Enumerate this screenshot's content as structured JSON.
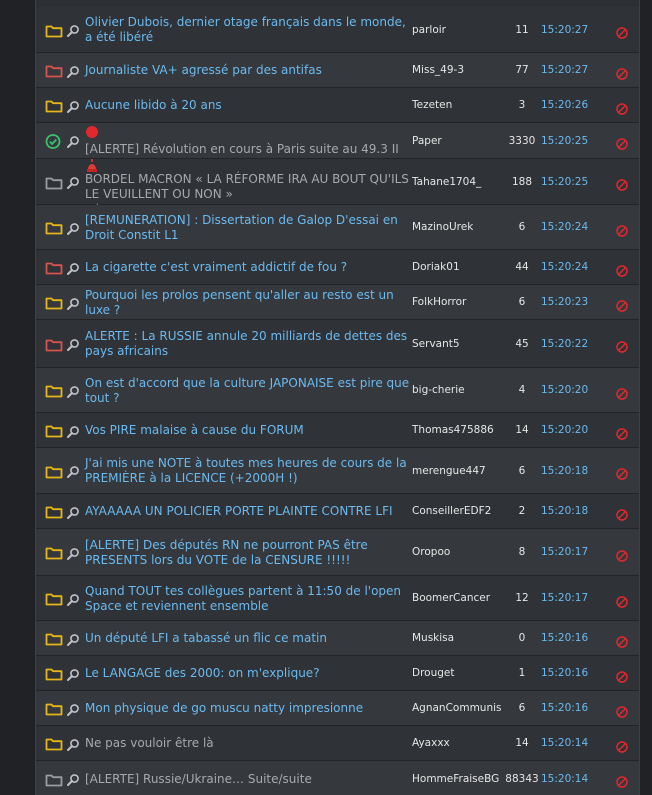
{
  "colors": {
    "folder_yellow": "#e8b61a",
    "folder_red": "#d9534f",
    "folder_dark": "#9a9da2",
    "link_blue": "#6bbaf0",
    "delete_red": "#e0282e",
    "pinned_green": "#39c26b"
  },
  "topics": [
    {
      "icon": "folder-yellow-icon",
      "title": "Olivier Dubois, dernier otage français dans le monde, a été libéré",
      "author": "parloir",
      "count": "11",
      "time": "15:20:27"
    },
    {
      "icon": "folder-red-icon",
      "title": "Journaliste VA+ agressé par des antifas",
      "author": "Miss_49-3",
      "count": "77",
      "time": "15:20:27"
    },
    {
      "icon": "folder-yellow-icon",
      "title": "Aucune libido à 20 ans",
      "author": "Tezeten",
      "count": "3",
      "time": "15:20:26"
    },
    {
      "icon": "check-circle-icon",
      "prefix_icon": "red-dot-icon",
      "title": "[ALERTE] Révolution en cours à Paris suite au 49.3 II",
      "author": "Paper",
      "count": "3330",
      "time": "15:20:25",
      "read": true
    },
    {
      "icon": "folder-dark-icon",
      "prefix_icon": "siren-icon",
      "suffix_icon": "fire-icon",
      "title": "BORDEL MACRON « LA RÉFORME IRA AU BOUT QU'ILS LE VEUILLENT OU NON »",
      "author": "Tahane1704_",
      "count": "188",
      "time": "15:20:25",
      "read": true
    },
    {
      "icon": "folder-yellow-icon",
      "title": "[REMUNERATION] : Dissertation de Galop D'essai en Droit Constit L1",
      "author": "MazinoUrek",
      "count": "6",
      "time": "15:20:24"
    },
    {
      "icon": "folder-red-icon",
      "title": "La cigarette c'est vraiment addictif de fou ?",
      "author": "Doriak01",
      "count": "44",
      "time": "15:20:24"
    },
    {
      "icon": "folder-yellow-icon",
      "title": "Pourquoi les prolos pensent qu'aller au resto est un luxe ?",
      "author": "FolkHorror",
      "count": "6",
      "time": "15:20:23"
    },
    {
      "icon": "folder-red-icon",
      "title": "ALERTE : La RUSSIE annule 20 milliards de dettes des pays africains",
      "author": "Servant5",
      "count": "45",
      "time": "15:20:22"
    },
    {
      "icon": "folder-yellow-icon",
      "title": "On est d'accord que la culture JAPONAISE est pire que tout ?",
      "author": "big-cherie",
      "count": "4",
      "time": "15:20:20"
    },
    {
      "icon": "folder-yellow-icon",
      "title": "Vos PIRE malaise à cause du FORUM",
      "author": "Thomas475886",
      "count": "14",
      "time": "15:20:20"
    },
    {
      "icon": "folder-yellow-icon",
      "title": "J'ai mis une NOTE à toutes mes heures de cours de la PREMIÈRE à la LICENCE (+2000H !)",
      "author": "merengue447",
      "count": "6",
      "time": "15:20:18"
    },
    {
      "icon": "folder-yellow-icon",
      "title": "AYAAAAA UN POLICIER PORTE PLAINTE CONTRE LFI",
      "author": "ConseillerEDF2",
      "count": "2",
      "time": "15:20:18"
    },
    {
      "icon": "folder-yellow-icon",
      "title": "[ALERTE] Des députés RN ne pourront PAS être PRESENTS lors du VOTE de la CENSURE !!!!!",
      "author": "Oropoo",
      "count": "8",
      "time": "15:20:17"
    },
    {
      "icon": "folder-yellow-icon",
      "title": "Quand TOUT tes collègues partent à 11:50 de l'open Space et reviennent ensemble",
      "author": "BoomerCancer",
      "count": "12",
      "time": "15:20:17"
    },
    {
      "icon": "folder-yellow-icon",
      "title": "Un député LFI a tabassé un flic ce matin",
      "author": "Muskisa",
      "count": "0",
      "time": "15:20:16"
    },
    {
      "icon": "folder-yellow-icon",
      "title": "Le LANGAGE des 2000: on m'explique?",
      "author": "Drouget",
      "count": "1",
      "time": "15:20:16"
    },
    {
      "icon": "folder-yellow-icon",
      "title": "Mon physique de go muscu natty impresionne",
      "author": "AgnanCommunis",
      "count": "6",
      "time": "15:20:16"
    },
    {
      "icon": "folder-yellow-icon",
      "title": "Ne pas vouloir être là",
      "author": "Ayaxxx",
      "count": "14",
      "time": "15:20:14",
      "read": true
    },
    {
      "icon": "folder-dark-icon",
      "title": "[ALERTE] Russie/Ukraine… Suite/suite",
      "author": "HommeFraiseBG",
      "count": "88343",
      "time": "15:20:14",
      "read": true
    }
  ]
}
